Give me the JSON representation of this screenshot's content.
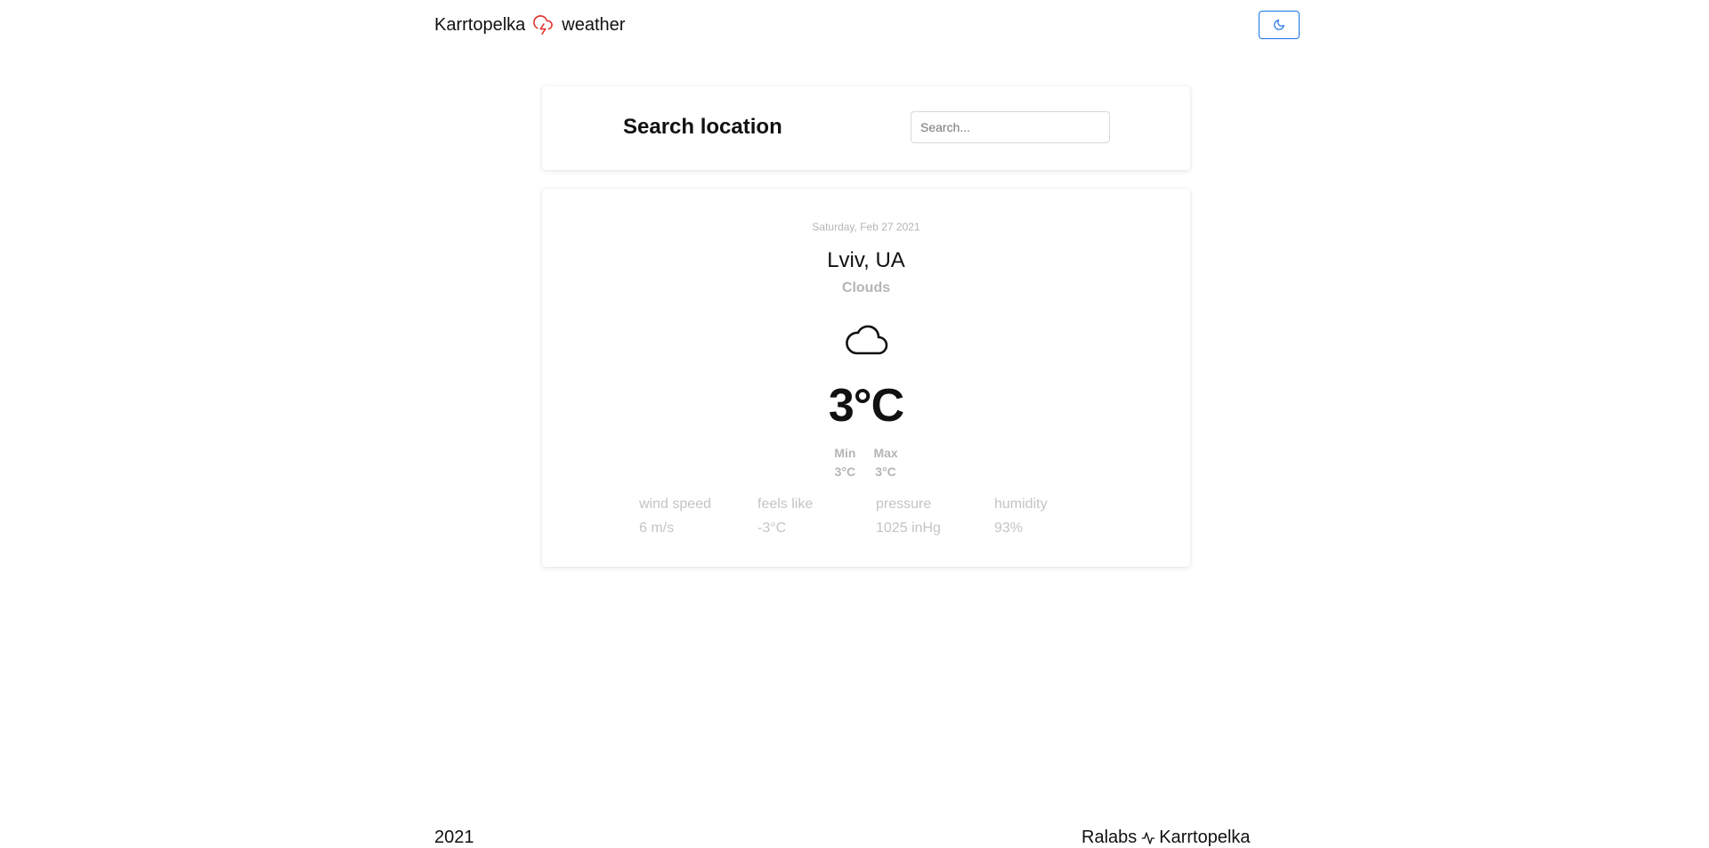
{
  "header": {
    "brand_left": "Karrtopelka",
    "brand_right": "weather",
    "brand_icon": "cloud-lightning-icon",
    "brand_icon_color": "#e53935",
    "theme_toggle_icon": "moon-icon",
    "accent_color": "#1a73e8"
  },
  "search": {
    "title": "Search location",
    "placeholder": "Search...",
    "value": ""
  },
  "weather": {
    "date": "Saturday, Feb 27 2021",
    "city": "Lviv, UA",
    "condition": "Clouds",
    "icon": "cloud-icon",
    "temperature": "3°C",
    "min_label": "Min",
    "min_value": "3°C",
    "max_label": "Max",
    "max_value": "3°C",
    "stats": [
      {
        "label": "wind speed",
        "value": "6 m/s"
      },
      {
        "label": "feels like",
        "value": "-3°C"
      },
      {
        "label": "pressure",
        "value": "1025 inHg"
      },
      {
        "label": "humidity",
        "value": "93%"
      }
    ]
  },
  "footer": {
    "year": "2021",
    "brand_left": "Ralabs",
    "brand_icon": "pulse-icon",
    "brand_right": "Karrtopelka"
  }
}
